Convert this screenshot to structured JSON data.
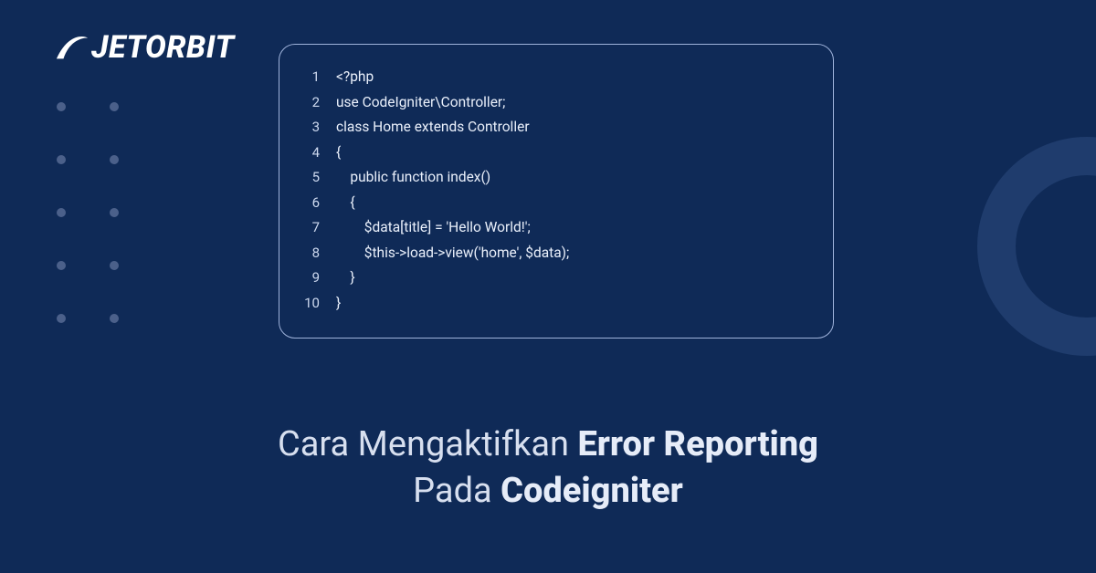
{
  "brand": {
    "name": "JETORBIT"
  },
  "code": {
    "lines": [
      {
        "n": "1",
        "text": "<?php"
      },
      {
        "n": "2",
        "text": "use CodeIgniter\\Controller;"
      },
      {
        "n": "3",
        "text": "class Home extends Controller"
      },
      {
        "n": "4",
        "text": "{"
      },
      {
        "n": "5",
        "text": "    public function index()"
      },
      {
        "n": "6",
        "text": "    {"
      },
      {
        "n": "7",
        "text": "        $data[title] = 'Hello World!';"
      },
      {
        "n": "8",
        "text": "        $this->load->view('home', $data);"
      },
      {
        "n": "9",
        "text": "    }"
      },
      {
        "n": "10",
        "text": "}"
      }
    ]
  },
  "headline": {
    "part1": "Cara Mengaktifkan ",
    "bold1": "Error Reporting",
    "part2": "Pada ",
    "bold2": "Codeigniter"
  }
}
